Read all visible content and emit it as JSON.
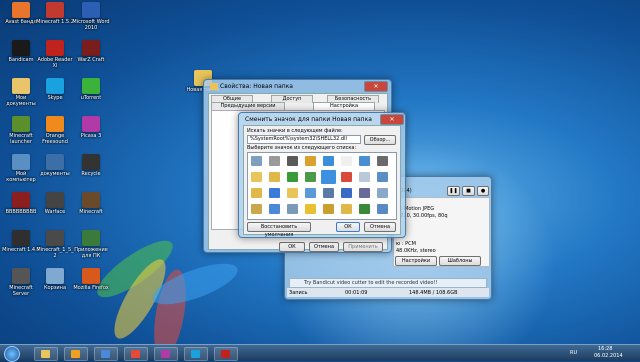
{
  "desktop": {
    "icons": [
      {
        "label": "Avast бандл",
        "icon": "avast-icon",
        "color": "#e8752b"
      },
      {
        "label": "Minecraft 1.5.2",
        "icon": "minecraft-icon",
        "color": "#c23a2f"
      },
      {
        "label": "Microsoft Word 2010",
        "icon": "word-icon",
        "color": "#2b5fb3"
      },
      {
        "label": "Bandicam",
        "icon": "bandicam-icon",
        "color": "#1a1a1a"
      },
      {
        "label": "Adobe Reader XI",
        "icon": "adobe-reader-icon",
        "color": "#c0231d"
      },
      {
        "label": "WarZ Craft",
        "icon": "warz-icon",
        "color": "#7a1d1d"
      },
      {
        "label": "Мои документы",
        "icon": "documents-folder-icon",
        "color": "#e9c46a"
      },
      {
        "label": "Skype",
        "icon": "skype-icon",
        "color": "#1aa1e0"
      },
      {
        "label": "uTorrent",
        "icon": "utorrent-icon",
        "color": "#3bb33b"
      },
      {
        "label": "Minecraft launcher",
        "icon": "minecraft-grass-icon",
        "color": "#5a8f2b"
      },
      {
        "label": "Orange Freesound",
        "icon": "freesound-icon",
        "color": "#f08a1c"
      },
      {
        "label": "Picasa 3",
        "icon": "picasa-icon",
        "color": "#b03aa8"
      },
      {
        "label": "Мой компьютер",
        "icon": "computer-icon",
        "color": "#5a8fc4"
      },
      {
        "label": "документы",
        "icon": "monitor-icon",
        "color": "#3c6fa8"
      },
      {
        "label": "Recycle",
        "icon": "game-recycle-icon",
        "color": "#333333"
      },
      {
        "label": "BBBBBBBBB",
        "icon": "game-icon",
        "color": "#8b1f1f"
      },
      {
        "label": "Warface",
        "icon": "warface-icon",
        "color": "#444444"
      },
      {
        "label": "Minecraft",
        "icon": "minecraft-block-icon",
        "color": "#6b4a2b"
      },
      {
        "label": "Minecraft 1.4.7",
        "icon": "minecraft-old-icon",
        "color": "#2f2f2f"
      },
      {
        "label": "Minecraft_1_5_2",
        "icon": "minecraft-pack-icon",
        "color": "#4a4a4a"
      },
      {
        "label": "Приложение для ПК",
        "icon": "app-icon",
        "color": "#3a7a3a"
      },
      {
        "label": "Minecraft Server",
        "icon": "server-icon",
        "color": "#555555"
      },
      {
        "label": "Корзина",
        "icon": "recycle-bin-icon",
        "color": "#7fa9d1"
      },
      {
        "label": "Mozilla Firefox",
        "icon": "firefox-icon",
        "color": "#d9581c"
      }
    ],
    "folder": {
      "label": "Новая папка",
      "icon": "new-folder-icon"
    }
  },
  "properties_dialog": {
    "title": "Свойства: Новая папка",
    "tabs_row1": [
      "Общие",
      "Доступ",
      "Безопасность"
    ],
    "tabs_row2": [
      "Предыдущие версии",
      "Настройка"
    ],
    "ok": "ОК",
    "cancel": "Отмена",
    "apply": "Применить"
  },
  "change_icon_dialog": {
    "title": "Сменить значок для папки Новая папка",
    "search_label": "Искать значки в следующем файле:",
    "path_value": "%SystemRoot%\\system32\\SHELL32.dll",
    "browse": "Обзор...",
    "list_label": "Выберите значок из следующего списка:",
    "restore_defaults": "Восстановить умолчания",
    "ok": "ОК",
    "cancel": "Отмена",
    "icon_grid": [
      {
        "name": "floppy-icon",
        "color": "#7f9fbf"
      },
      {
        "name": "drive-icon",
        "color": "#9a9a9a"
      },
      {
        "name": "printer-icon",
        "color": "#5a5a5a"
      },
      {
        "name": "search-key-icon",
        "color": "#d9a22c"
      },
      {
        "name": "network-icon",
        "color": "#3b8fd9"
      },
      {
        "name": "empty-icon",
        "color": "#f0f0f0"
      },
      {
        "name": "monitors-icon",
        "color": "#4a8fd1"
      },
      {
        "name": "printer-fax-icon",
        "color": "#6a6a6a"
      },
      {
        "name": "folder-icon",
        "color": "#e8c45a"
      },
      {
        "name": "folder-open-icon",
        "color": "#e0b84a"
      },
      {
        "name": "tree-icon",
        "color": "#3a9a3a"
      },
      {
        "name": "arrow-icon",
        "color": "#4a9a4a"
      },
      {
        "name": "selected-icon",
        "color": "#3d8fe0"
      },
      {
        "name": "delete-icon",
        "color": "#d94a3b"
      },
      {
        "name": "cd-icon",
        "color": "#b9c9d9"
      },
      {
        "name": "computer-icon",
        "color": "#5a8fc4"
      },
      {
        "name": "folder-gear-icon",
        "color": "#e0b84a"
      },
      {
        "name": "globe-icon",
        "color": "#3a7ad9"
      },
      {
        "name": "mail-icon",
        "color": "#e8c45a"
      },
      {
        "name": "window-icon",
        "color": "#5a9ad9"
      },
      {
        "name": "grid-icon",
        "color": "#5a7aa8"
      },
      {
        "name": "help-icon",
        "color": "#3a6ac4"
      },
      {
        "name": "sound-icon",
        "color": "#6a6a9a"
      },
      {
        "name": "frame-icon",
        "color": "#8aa8c8"
      },
      {
        "name": "shield-folder-icon",
        "color": "#c8a84a"
      },
      {
        "name": "chart-icon",
        "color": "#4a8ad9"
      },
      {
        "name": "pc-icon",
        "color": "#7a9ab8"
      },
      {
        "name": "star-icon",
        "color": "#e8c030"
      },
      {
        "name": "lock-icon",
        "color": "#c8a030"
      },
      {
        "name": "cog-folder-icon",
        "color": "#e0b84a"
      },
      {
        "name": "pen-icon",
        "color": "#3a8a3a"
      },
      {
        "name": "user-icon",
        "color": "#5a8ac4"
      }
    ]
  },
  "bandicam": {
    "value_1024": "1024)",
    "codec_line": "л : Motion JPEG",
    "video_line": "ю720, 30.00fps, 80q",
    "audio_line": "ю : PCM",
    "audio_detail": "48.0KHz, stereo",
    "settings_btn": "Настройки",
    "templates_btn": "Шаблоны",
    "promo": "Try Bandicut video cutter to edit the recorded video!!",
    "status_label": "Запись",
    "time": "00:01:09",
    "size": "148.4MB / 108.6GB"
  },
  "taskbar": {
    "apps": [
      {
        "name": "explorer",
        "icon": "folder-icon",
        "color": "#e8c45a"
      },
      {
        "name": "media",
        "icon": "play-icon",
        "color": "#f0a020"
      },
      {
        "name": "browser",
        "icon": "browser-icon",
        "color": "#4a8ad9"
      },
      {
        "name": "yandex",
        "icon": "yandex-icon",
        "color": "#e84a3a"
      },
      {
        "name": "picasa",
        "icon": "picasa-icon",
        "color": "#b03aa8"
      },
      {
        "name": "skype",
        "icon": "skype-icon",
        "color": "#1aa1e0"
      },
      {
        "name": "bandicam",
        "icon": "bandicam-icon",
        "color": "#c0231d"
      }
    ],
    "tray": "RU",
    "clock_time": "16:28",
    "clock_date": "06.02.2014"
  }
}
